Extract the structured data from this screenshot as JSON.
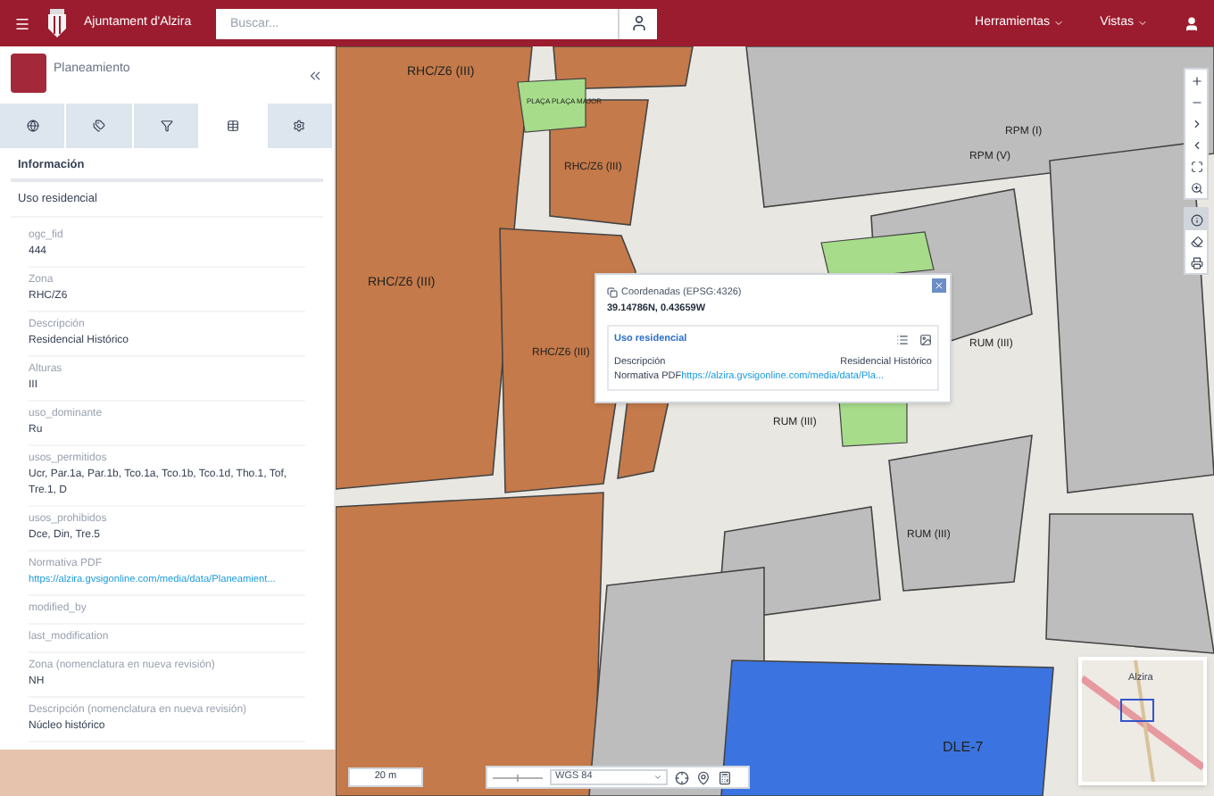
{
  "header": {
    "brand": "Ajuntament d'Alzira",
    "search": {
      "placeholder": "Buscar..."
    },
    "menus": [
      {
        "label": "Herramientas"
      },
      {
        "label": "Vistas"
      }
    ]
  },
  "sidebar": {
    "title": "Planeamiento",
    "tabs": [
      {
        "kind": "globe",
        "selected": false
      },
      {
        "kind": "tags",
        "selected": false
      },
      {
        "kind": "filter",
        "selected": false
      },
      {
        "kind": "table",
        "selected": true
      },
      {
        "kind": "settings",
        "selected": false
      }
    ],
    "section_title": "Información",
    "layer_title": "Uso residencial",
    "fields": [
      {
        "label": "ogc_fid",
        "value": "444",
        "kind": "text"
      },
      {
        "label": "Zona",
        "value": "RHC/Z6",
        "kind": "text"
      },
      {
        "label": "Descripción",
        "value": "Residencial Histórico",
        "kind": "text"
      },
      {
        "label": "Alturas",
        "value": "III",
        "kind": "text"
      },
      {
        "label": "uso_dominante",
        "value": "Ru",
        "kind": "text"
      },
      {
        "label": "usos_permitidos",
        "value": "Ucr, Par.1a, Par.1b, Tco.1a, Tco.1b, Tco.1d, Tho.1, Tof, Tre.1, D",
        "kind": "text"
      },
      {
        "label": "usos_prohibidos",
        "value": "Dce, Din, Tre.5",
        "kind": "text"
      },
      {
        "label": "Normativa PDF",
        "value": "https://alzira.gvsigonline.com/media/data/Planeamient...",
        "kind": "link"
      },
      {
        "label": "modified_by",
        "kind": "text"
      },
      {
        "label": "last_modification",
        "kind": "text"
      },
      {
        "label": "Zona (nomenclatura en nueva revisión)",
        "value": "NH",
        "kind": "text"
      },
      {
        "label": "Descripción (nomenclatura en nueva revisión)",
        "value": "Núcleo histórico",
        "kind": "text"
      }
    ]
  },
  "map_labels": [
    "RHC/Z6 (III)",
    "PLAÇA PLAÇA MAJOR",
    "RHC/Z6 (III)",
    "RPM (I)",
    "RPM (V)",
    "RHC/Z6 (III)",
    "RHC/Z6 (III)",
    "RUM (III)",
    "RUM (III)",
    "RUM (III)",
    "DLE-7"
  ],
  "popup": {
    "coords_label": "Coordenadas (EPSG:4326)",
    "coords": "39.14786N, 0.43659W",
    "layer": "Uso residencial",
    "rows": [
      {
        "label": "Descripción",
        "value": "Residencial Histórico",
        "kind": "text"
      },
      {
        "label": "Normativa PDF",
        "value": "https://alzira.gvsigonline.com/media/data/Pla...",
        "kind": "link"
      }
    ]
  },
  "toolbar": [
    {
      "kind": "zoom-in",
      "selected": false
    },
    {
      "kind": "zoom-out",
      "selected": false
    },
    {
      "kind": "next",
      "selected": false
    },
    {
      "kind": "prev",
      "selected": false
    },
    {
      "kind": "extent",
      "selected": false
    },
    {
      "kind": "zoom-box",
      "selected": false
    },
    {
      "kind": "info",
      "selected": true
    },
    {
      "kind": "eraser",
      "selected": false
    },
    {
      "kind": "print",
      "selected": false
    }
  ],
  "scale": "20 m",
  "crs": "WGS 84",
  "minimap_label": "Alzira"
}
